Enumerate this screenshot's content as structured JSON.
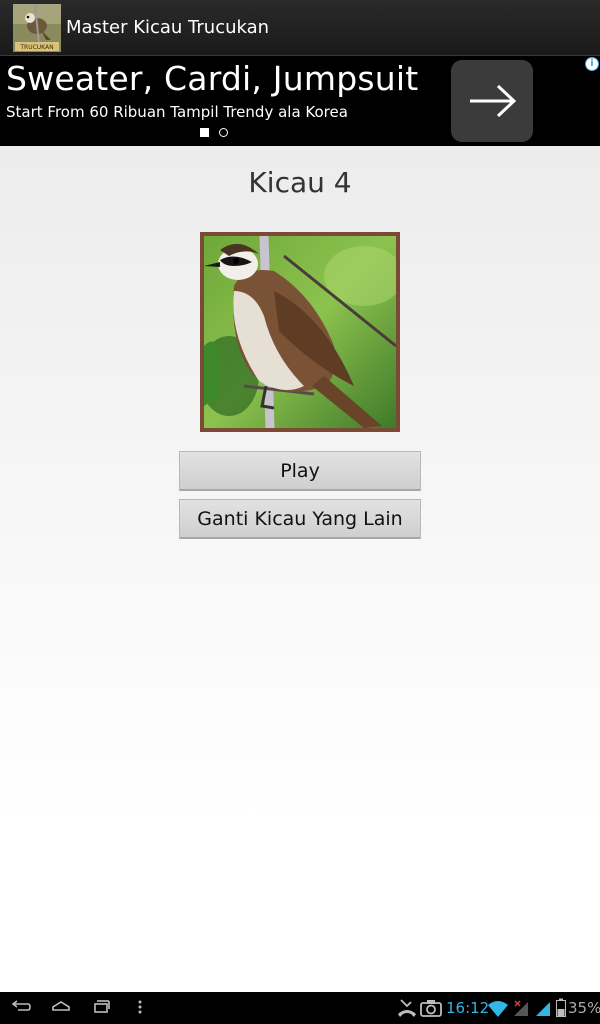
{
  "action_bar": {
    "app_title": "Master Kicau Trucukan",
    "app_icon": "bird-app-icon",
    "icon_caption": "TRUCUKAN"
  },
  "ad": {
    "headline": "Sweater, Cardi, Jumpsuit",
    "subtitle": "Start From 60 Ribuan Tampil Trendy ala Korea",
    "arrow_icon": "arrow-right-icon",
    "info_icon": "info-icon",
    "info_glyph": "i",
    "pages": 2,
    "selected_page": 1
  },
  "main": {
    "title": "Kicau 4",
    "image": "bird-photo",
    "play_label": "Play",
    "ganti_label": "Ganti Kicau Yang Lain"
  },
  "system_bar": {
    "time": "16:12",
    "battery": "35%",
    "accent_color": "#33b5e5",
    "nav_icons": [
      "back-icon",
      "home-icon",
      "recent-apps-icon",
      "menu-icon"
    ],
    "status_icons": [
      "missed-call-icon",
      "camera-icon",
      "wifi-icon",
      "signal-icon",
      "battery-icon"
    ]
  }
}
